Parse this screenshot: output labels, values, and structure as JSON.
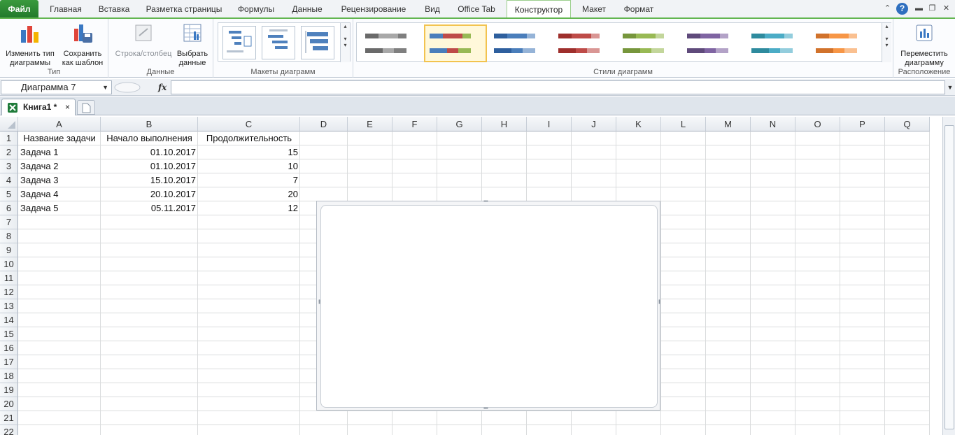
{
  "ribbon_tabs": [
    "Файл",
    "Главная",
    "Вставка",
    "Разметка страницы",
    "Формулы",
    "Данные",
    "Рецензирование",
    "Вид",
    "Office Tab",
    "Конструктор",
    "Макет",
    "Формат"
  ],
  "active_tab": "Конструктор",
  "groups": {
    "type": {
      "label": "Тип",
      "change_type": "Изменить тип диаграммы",
      "save_template": "Сохранить как шаблон"
    },
    "data": {
      "label": "Данные",
      "switch_row_col": "Строка/столбец",
      "select_data": "Выбрать данные"
    },
    "layouts": {
      "label": "Макеты диаграмм"
    },
    "styles": {
      "label": "Стили диаграмм"
    },
    "location": {
      "label": "Расположение",
      "move_chart": "Переместить диаграмму"
    }
  },
  "style_palettes": [
    [
      "#6a6a6a",
      "#a8a8a8",
      "#7f7f7f"
    ],
    [
      "#4a7ebb",
      "#be4b48",
      "#98b954"
    ],
    [
      "#2e5f9e",
      "#4a7ebb",
      "#95b3d7"
    ],
    [
      "#9e2f2c",
      "#be4b48",
      "#d99694"
    ],
    [
      "#77963c",
      "#98b954",
      "#c3d69b"
    ],
    [
      "#5f4a7b",
      "#7f64a2",
      "#b3a2c7"
    ],
    [
      "#2e8b9e",
      "#4bacc6",
      "#93cddd"
    ],
    [
      "#d1722b",
      "#f79646",
      "#fac090"
    ]
  ],
  "formula_bar": {
    "name_box": "Диаграмма 7",
    "fx": "fx",
    "formula": ""
  },
  "workbook_tab": {
    "name": "Книга1 *",
    "close": "×"
  },
  "columns": [
    "A",
    "B",
    "C",
    "D",
    "E",
    "F",
    "G",
    "H",
    "I",
    "J",
    "K",
    "L",
    "M",
    "N",
    "O",
    "P",
    "Q"
  ],
  "rows": [
    "1",
    "2",
    "3",
    "4",
    "5",
    "6",
    "7",
    "8",
    "9",
    "10",
    "11",
    "12",
    "13",
    "14",
    "15",
    "16",
    "17",
    "18",
    "19",
    "20",
    "21",
    "22"
  ],
  "table": {
    "headers": [
      "Название задачи",
      "Начало выполнения",
      "Продолжительность"
    ],
    "rows": [
      [
        "Задача 1",
        "01.10.2017",
        "15"
      ],
      [
        "Задача 2",
        "01.10.2017",
        "10"
      ],
      [
        "Задача 3",
        "15.10.2017",
        "7"
      ],
      [
        "Задача 4",
        "20.10.2017",
        "20"
      ],
      [
        "Задача 5",
        "05.11.2017",
        "12"
      ]
    ]
  }
}
